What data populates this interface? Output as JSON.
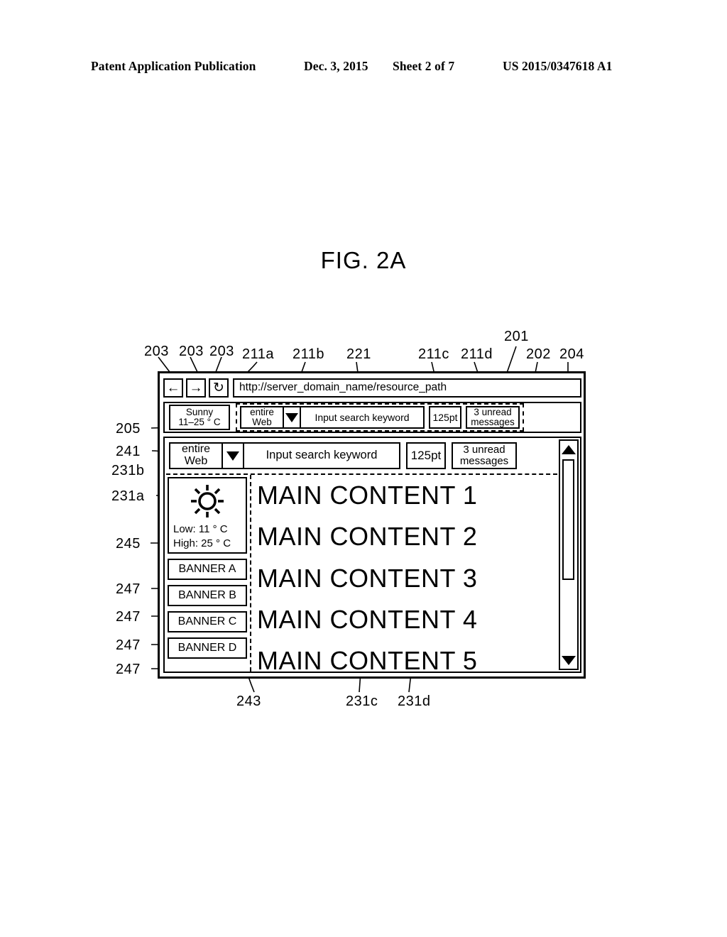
{
  "header": {
    "publication": "Patent Application Publication",
    "date": "Dec. 3, 2015",
    "sheet": "Sheet 2 of 7",
    "number": "US 2015/0347618 A1"
  },
  "figure": {
    "title": "FIG. 2A"
  },
  "reference_labels": {
    "top": [
      {
        "id": "ref-203-a",
        "text": "203"
      },
      {
        "id": "ref-203-b",
        "text": "203"
      },
      {
        "id": "ref-203-c",
        "text": "203"
      },
      {
        "id": "ref-211a",
        "text": "211a"
      },
      {
        "id": "ref-211b",
        "text": "211b"
      },
      {
        "id": "ref-221",
        "text": "221"
      },
      {
        "id": "ref-211c",
        "text": "211c"
      },
      {
        "id": "ref-211d",
        "text": "211d"
      },
      {
        "id": "ref-201",
        "text": "201"
      },
      {
        "id": "ref-202",
        "text": "202"
      },
      {
        "id": "ref-204",
        "text": "204"
      }
    ],
    "left": [
      {
        "id": "ref-205",
        "text": "205"
      },
      {
        "id": "ref-241",
        "text": "241"
      },
      {
        "id": "ref-231b",
        "text": "231b"
      },
      {
        "id": "ref-231a",
        "text": "231a"
      },
      {
        "id": "ref-245",
        "text": "245"
      },
      {
        "id": "ref-247-a",
        "text": "247"
      },
      {
        "id": "ref-247-b",
        "text": "247"
      },
      {
        "id": "ref-247-c",
        "text": "247"
      },
      {
        "id": "ref-247-d",
        "text": "247"
      }
    ],
    "bottom": [
      {
        "id": "ref-243",
        "text": "243"
      },
      {
        "id": "ref-231c",
        "text": "231c"
      },
      {
        "id": "ref-231d",
        "text": "231d"
      }
    ]
  },
  "browser": {
    "nav": {
      "back_icon": "arrow-left-icon",
      "back_glyph": "←",
      "forward_icon": "arrow-right-icon",
      "forward_glyph": "→",
      "reload_icon": "reload-icon",
      "reload_glyph": "↻",
      "url_value": "http://server_domain_name/resource_path",
      "url_placeholder": "http://server_domain_name/resource_path"
    },
    "toolbar": {
      "weather": {
        "condition": "Sunny",
        "range": "11–25 ° C"
      },
      "search_group": {
        "scope_line1": "entire",
        "scope_line2": "Web",
        "dropdown_icon": "chevron-down-icon",
        "input_placeholder": "Input search keyword",
        "input_value": "Input search keyword",
        "points": "125pt",
        "mail_line1": "3 unread",
        "mail_line2": "messages"
      }
    },
    "page": {
      "widget_row": {
        "scope_line1": "entire",
        "scope_line2": "Web",
        "dropdown_icon": "chevron-down-icon",
        "input_placeholder": "Input search keyword",
        "input_value": "Input search keyword",
        "points": "125pt",
        "mail_line1": "3 unread",
        "mail_line2": "messages"
      },
      "sidebar": {
        "weather": {
          "icon": "sun-icon",
          "low": "Low: 11 °  C",
          "high": "High: 25 °  C"
        },
        "banners": [
          "BANNER A",
          "BANNER B",
          "BANNER C",
          "BANNER D"
        ]
      },
      "main": {
        "lines": [
          "MAIN CONTENT 1",
          "MAIN CONTENT 2",
          "MAIN CONTENT 3",
          "MAIN CONTENT 4",
          "MAIN CONTENT 5"
        ]
      },
      "scrollbar": {
        "up_icon": "triangle-up-icon",
        "down_icon": "triangle-down-icon",
        "thumb": "scrollbar-thumb"
      }
    }
  },
  "colors": {
    "ink": "#000000",
    "paper": "#ffffff"
  }
}
